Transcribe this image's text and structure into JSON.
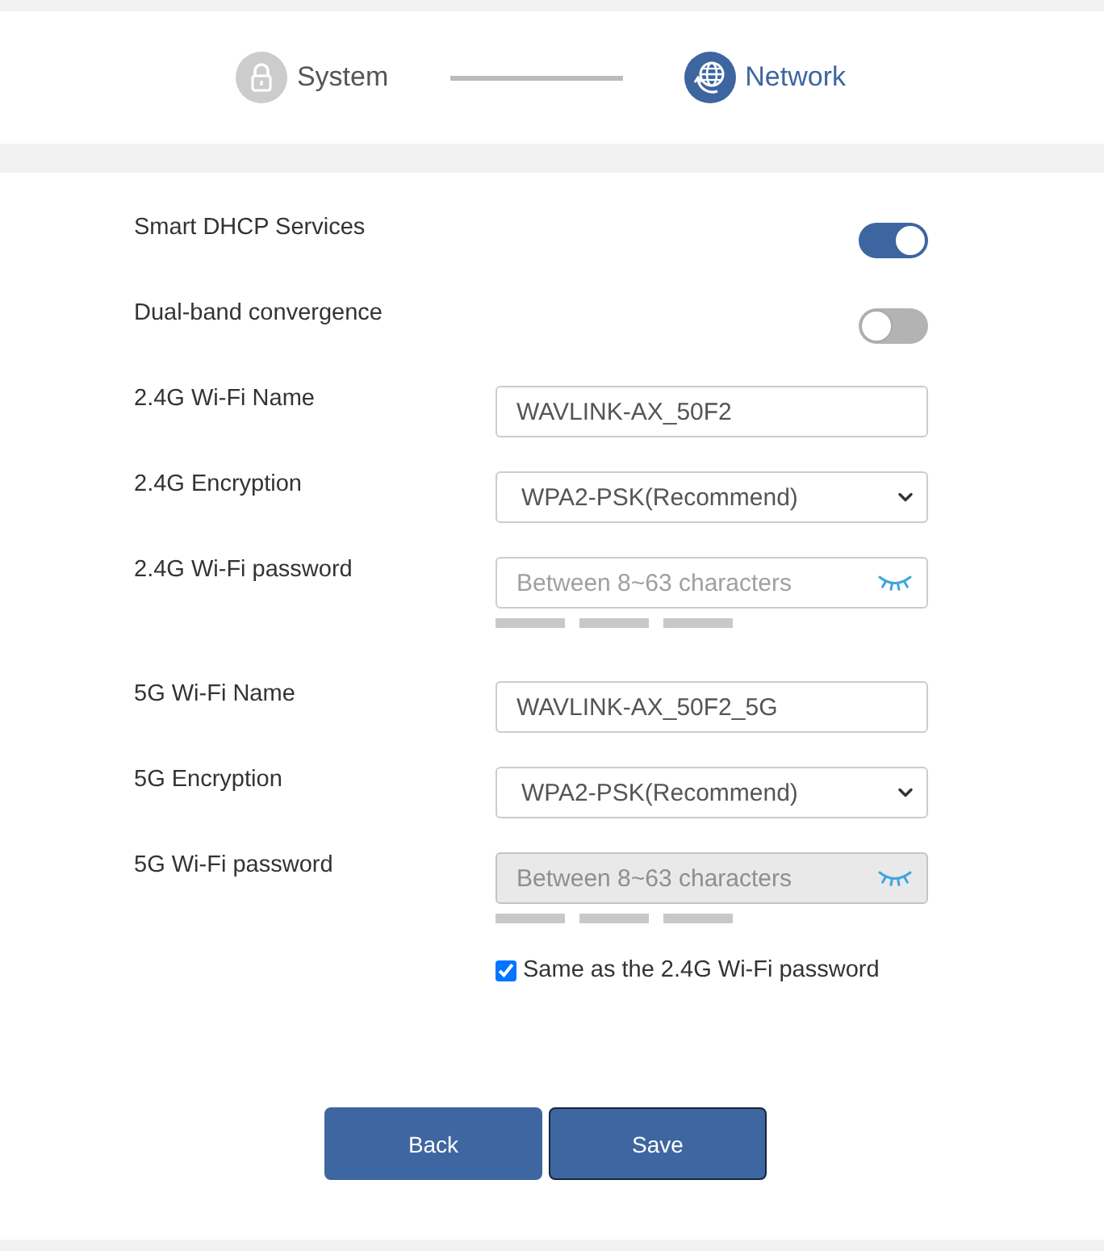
{
  "steps": [
    {
      "kind": "lock",
      "label": "System",
      "selected": false
    },
    {
      "kind": "globe",
      "label": "Network",
      "selected": true
    }
  ],
  "settings": [
    {
      "kind": "toggle",
      "label": "Smart DHCP Services",
      "on": true
    },
    {
      "kind": "toggle",
      "label": "Dual-band convergence",
      "on": false
    },
    {
      "kind": "text",
      "label": "2.4G Wi-Fi Name",
      "value": "WAVLINK-AX_50F2"
    },
    {
      "kind": "select",
      "label": "2.4G Encryption",
      "value": "WPA2-PSK(Recommend)"
    },
    {
      "kind": "password",
      "label": "2.4G Wi-Fi password",
      "placeholder": "Between 8~63 characters",
      "disabled": false
    },
    {
      "kind": "text",
      "label": "5G Wi-Fi Name",
      "value": "WAVLINK-AX_50F2_5G"
    },
    {
      "kind": "select",
      "label": "5G Encryption",
      "value": "WPA2-PSK(Recommend)"
    },
    {
      "kind": "password",
      "label": "5G Wi-Fi password",
      "placeholder": "Between 8~63 characters",
      "disabled": true,
      "same_as": {
        "label": "Same as the 2.4G Wi-Fi password",
        "checked": true
      }
    }
  ],
  "buttons": [
    {
      "label": "Back",
      "focused": false
    },
    {
      "label": "Save",
      "focused": true
    }
  ]
}
